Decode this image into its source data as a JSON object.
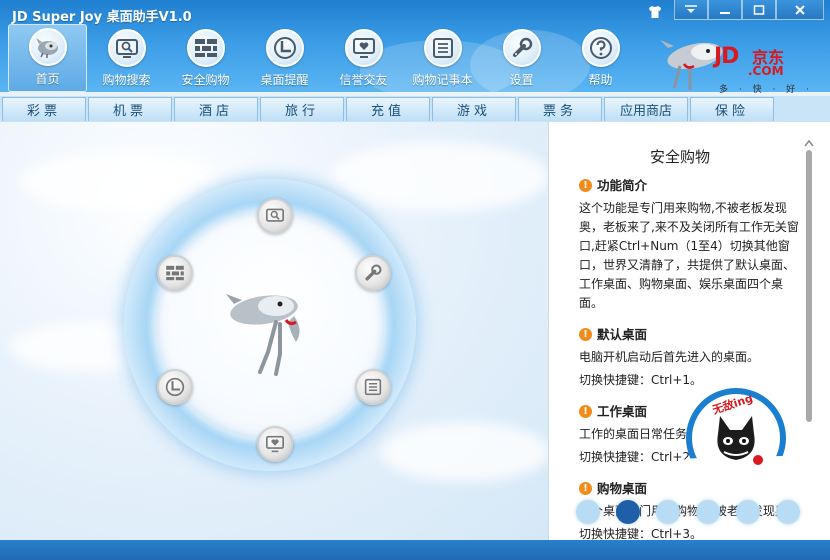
{
  "app": {
    "title": "JD Super Joy 桌面助手V1.0"
  },
  "window_controls": {
    "skin": "skin-icon",
    "menu": "menu-icon",
    "minimize": "minimize-icon",
    "maximize": "maximize-icon",
    "close": "close-icon"
  },
  "nav": [
    {
      "label": "首页",
      "icon": "home-icon",
      "active": true
    },
    {
      "label": "购物搜索",
      "icon": "search-icon"
    },
    {
      "label": "安全购物",
      "icon": "brick-wall-icon"
    },
    {
      "label": "桌面提醒",
      "icon": "clock-icon"
    },
    {
      "label": "信誉交友",
      "icon": "heart-monitor-icon"
    },
    {
      "label": "购物记事本",
      "icon": "notebook-icon"
    },
    {
      "label": "设置",
      "icon": "wrench-icon"
    },
    {
      "label": "帮助",
      "icon": "question-icon"
    }
  ],
  "logo": {
    "brand": "JD",
    "cn": "京东",
    "com": ".COM",
    "slogan": "多 · 快 · 好 · 省"
  },
  "tabs": [
    "彩票",
    "机票",
    "酒店",
    "旅行",
    "充值",
    "游戏",
    "票务",
    "应用商店",
    "保险"
  ],
  "side": {
    "title": "安全购物",
    "sections": [
      {
        "heading": "功能简介",
        "text": "这个功能是专门用来购物,不被老板发现奥，老板来了,来不及关闭所有工作无关窗口,赶紧Ctrl+Num（1至4）切换其他窗口，世界又清静了，共提供了默认桌面、工作桌面、购物桌面、娱乐桌面四个桌面。"
      },
      {
        "heading": "默认桌面",
        "text": "电脑开机启动后首先进入的桌面。",
        "shortcut": "切换快捷键：Ctrl+1。"
      },
      {
        "heading": "工作桌面",
        "text": "工作的桌面日常任务",
        "shortcut": "切换快捷键：Ctrl+2"
      },
      {
        "heading": "购物桌面",
        "text": "这个桌面专门用来购物,不被老板发现奥",
        "shortcut": "切换快捷键：Ctrl+3。"
      }
    ]
  },
  "badge": {
    "text": "无敌ing"
  },
  "colors": {
    "titlebar": "#2b8ad8",
    "accent": "#f08c1a",
    "jd_red": "#d71920",
    "dot_active": "#1f5ea8"
  }
}
